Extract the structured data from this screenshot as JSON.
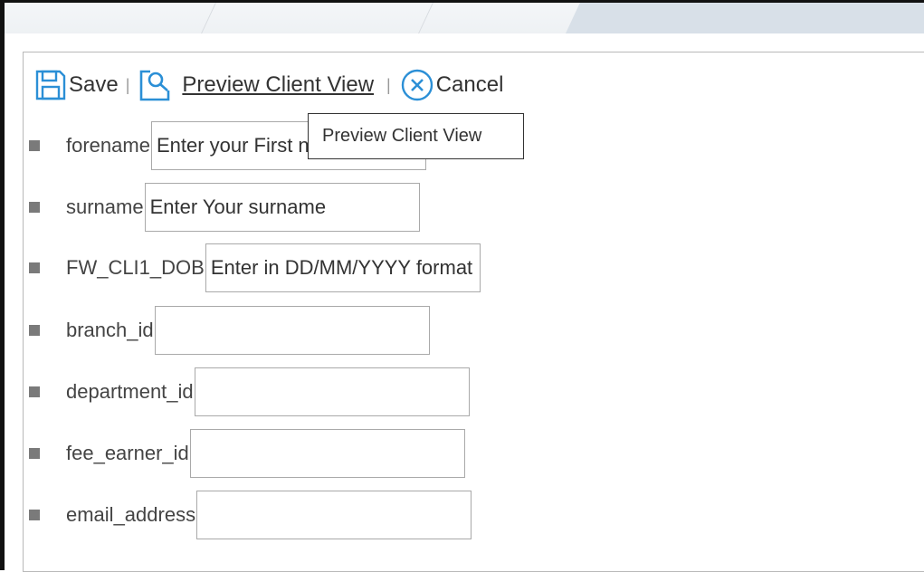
{
  "toolbar": {
    "save_label": "Save",
    "separator": "|",
    "preview_label": "Preview Client View",
    "cancel_label": "Cancel"
  },
  "tooltip": {
    "text": "Preview Client View"
  },
  "form": {
    "fields": [
      {
        "label": "forename",
        "placeholder": "Enter your First name",
        "value": ""
      },
      {
        "label": "surname",
        "placeholder": "Enter Your surname",
        "value": ""
      },
      {
        "label": "FW_CLI1_DOB",
        "placeholder": "Enter in DD/MM/YYYY format",
        "value": ""
      },
      {
        "label": "branch_id",
        "placeholder": "",
        "value": ""
      },
      {
        "label": "department_id",
        "placeholder": "",
        "value": ""
      },
      {
        "label": "fee_earner_id",
        "placeholder": "",
        "value": ""
      },
      {
        "label": "email_address",
        "placeholder": "",
        "value": ""
      }
    ]
  },
  "colors": {
    "icon_blue": "#2b8fd6",
    "bullet": "#7a7a7a",
    "border": "#a9a9a9"
  }
}
